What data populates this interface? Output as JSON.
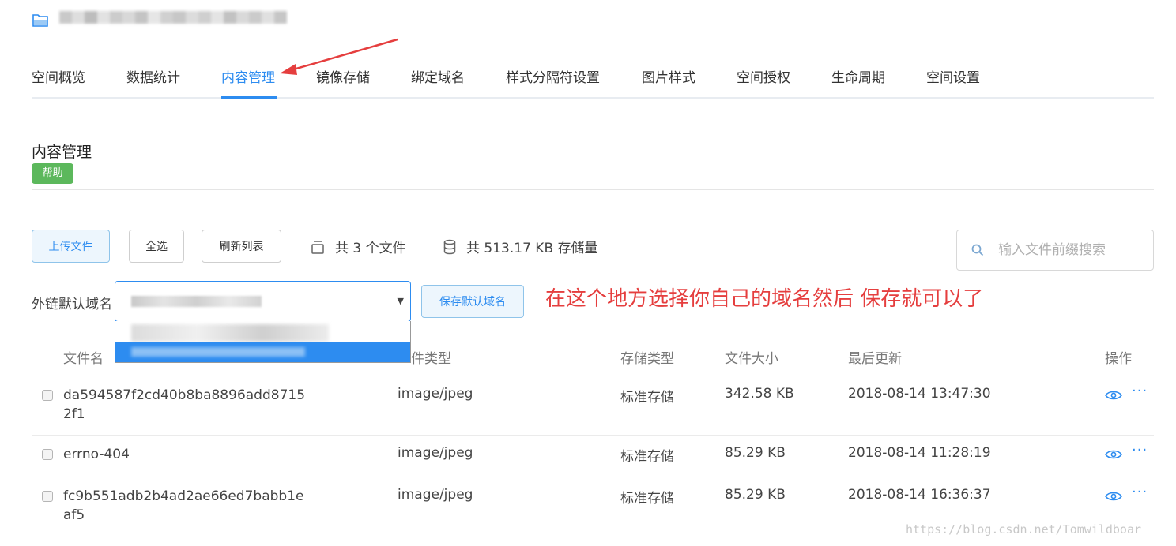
{
  "tabs": [
    "空间概览",
    "数据统计",
    "内容管理",
    "镜像存储",
    "绑定域名",
    "样式分隔符设置",
    "图片样式",
    "空间授权",
    "生命周期",
    "空间设置"
  ],
  "active_tab": "内容管理",
  "section": {
    "title": "内容管理",
    "help_label": "帮助"
  },
  "toolbar": {
    "upload_label": "上传文件",
    "select_all_label": "全选",
    "refresh_label": "刷新列表",
    "file_count_text": "共 3 个文件",
    "storage_text": "共 513.17 KB 存储量",
    "search_placeholder": "输入文件前缀搜索"
  },
  "domain": {
    "label": "外链默认域名",
    "save_label": "保存默认域名"
  },
  "annotation": "在这个地方选择你自己的域名然后  保存就可以了",
  "table": {
    "headers": {
      "name": "文件名",
      "type": "件类型",
      "storage": "存储类型",
      "size": "文件大小",
      "updated": "最后更新",
      "actions": "操作"
    },
    "rows": [
      {
        "name": "da594587f2cd40b8ba8896add87152f1",
        "type": "image/jpeg",
        "storage": "标准存储",
        "size": "342.58 KB",
        "updated": "2018-08-14 13:47:30"
      },
      {
        "name": "errno-404",
        "type": "image/jpeg",
        "storage": "标准存储",
        "size": "85.29 KB",
        "updated": "2018-08-14 11:28:19"
      },
      {
        "name": "fc9b551adb2b4ad2ae66ed7babb1eaf5",
        "type": "image/jpeg",
        "storage": "标准存储",
        "size": "85.29 KB",
        "updated": "2018-08-14 16:36:37"
      }
    ]
  },
  "watermark": "https://blog.csdn.net/Tomwildboar",
  "colors": {
    "accent": "#2d8cf0",
    "help_green": "#5cb85c",
    "annotation_red": "#e53e3e"
  }
}
